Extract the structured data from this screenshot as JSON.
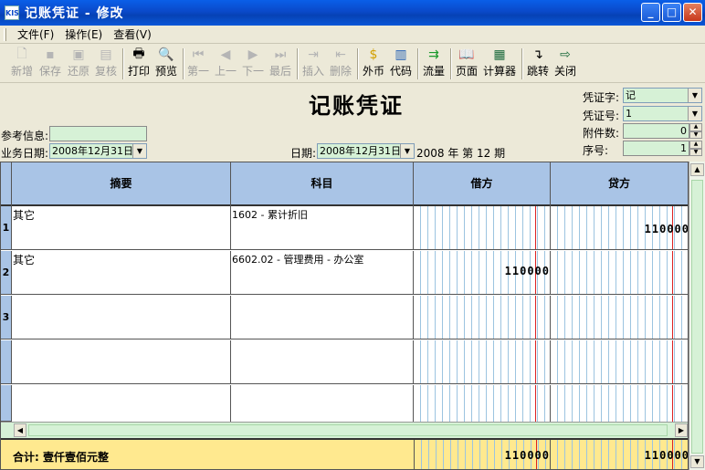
{
  "window": {
    "title": "记账凭证 - 修改",
    "icon_text": "KIS",
    "minimize": "_",
    "maximize": "□",
    "close": "✕"
  },
  "menu": [
    {
      "label": "文件(F)"
    },
    {
      "label": "操作(E)"
    },
    {
      "label": "查看(V)"
    }
  ],
  "toolbar": {
    "new": "新增",
    "save": "保存",
    "restore": "还原",
    "review": "复核",
    "print": "打印",
    "preview": "预览",
    "first": "第一",
    "prev": "上一",
    "next": "下一",
    "last": "最后",
    "insert": "插入",
    "delete": "删除",
    "currency": "外币",
    "code": "代码",
    "flow": "流量",
    "page": "页面",
    "calculator": "计算器",
    "jump": "跳转",
    "close": "关闭"
  },
  "header": {
    "doc_title": "记账凭证",
    "ref_label": "参考信息:",
    "ref_value": "",
    "biz_date_label": "业务日期:",
    "biz_date_value": "2008年12月31日",
    "date_label": "日期:",
    "date_value": "2008年12月31日",
    "period_text": "2008 年 第 12 期",
    "voucher_word_label": "凭证字:",
    "voucher_word_value": "记",
    "voucher_no_label": "凭证号:",
    "voucher_no_value": "1",
    "attach_label": "附件数:",
    "attach_value": "0",
    "seq_label": "序号:",
    "seq_value": "1"
  },
  "grid": {
    "headers": {
      "summary": "摘要",
      "account": "科目",
      "debit": "借方",
      "credit": "贷方"
    },
    "rows": [
      {
        "idx": "1",
        "summary": "其它",
        "account": "1602 - 累计折旧",
        "debit": "",
        "credit": "110000"
      },
      {
        "idx": "2",
        "summary": "其它",
        "account": "6602.02 - 管理费用 - 办公室",
        "debit": "110000",
        "credit": ""
      },
      {
        "idx": "3",
        "summary": "",
        "account": "",
        "debit": "",
        "credit": ""
      },
      {
        "idx": "",
        "summary": "",
        "account": "",
        "debit": "",
        "credit": ""
      },
      {
        "idx": "",
        "summary": "",
        "account": "",
        "debit": "",
        "credit": ""
      }
    ],
    "total": {
      "label": "合计: 壹仟壹佰元整",
      "debit": "110000",
      "credit": "110000"
    }
  }
}
